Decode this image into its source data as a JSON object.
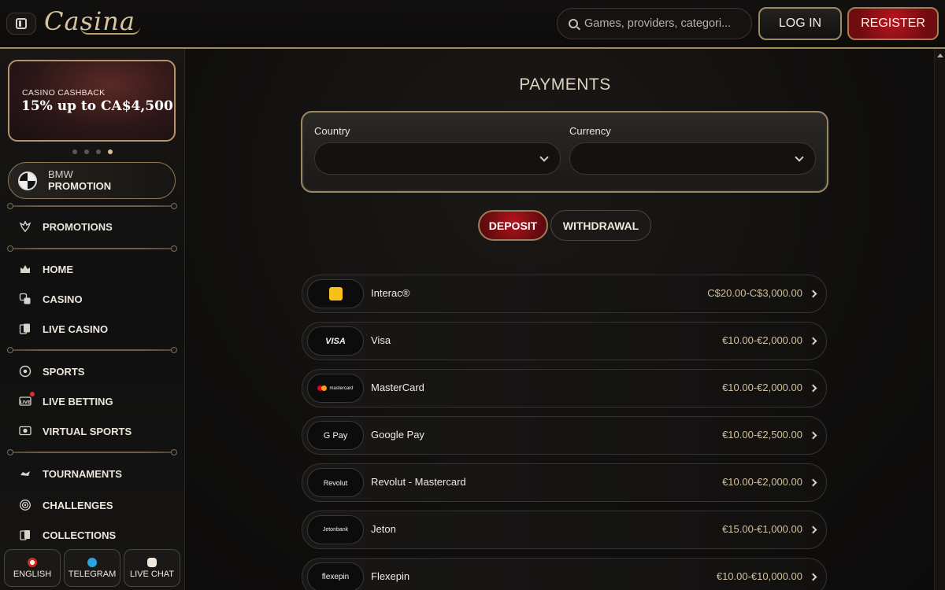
{
  "header": {
    "logo_text": "Casina",
    "search_placeholder": "Games, providers, categori...",
    "login_label": "LOG IN",
    "register_label": "REGISTER"
  },
  "sidebar": {
    "banner": {
      "kicker": "CASINO CASHBACK",
      "title": "15% up to CA$4,500",
      "slides": 4,
      "active_slide": 4
    },
    "bmw": {
      "line1": "BMW",
      "line2": "PROMOTION"
    },
    "items": [
      {
        "label": "PROMOTIONS",
        "icon": "promotions-icon"
      },
      {
        "label": "HOME",
        "icon": "home-icon"
      },
      {
        "label": "CASINO",
        "icon": "dice-icon"
      },
      {
        "label": "LIVE CASINO",
        "icon": "cards-icon"
      },
      {
        "label": "SPORTS",
        "icon": "soccer-ball-icon"
      },
      {
        "label": "LIVE BETTING",
        "icon": "live-icon"
      },
      {
        "label": "VIRTUAL SPORTS",
        "icon": "virtual-sports-icon"
      },
      {
        "label": "TOURNAMENTS",
        "icon": "tournaments-icon"
      },
      {
        "label": "CHALLENGES",
        "icon": "target-icon"
      },
      {
        "label": "COLLECTIONS",
        "icon": "collections-icon"
      }
    ],
    "footer": [
      {
        "label": "ENGLISH",
        "icon": "canada-flag-icon"
      },
      {
        "label": "TELEGRAM",
        "icon": "telegram-icon"
      },
      {
        "label": "LIVE CHAT",
        "icon": "chat-icon"
      }
    ]
  },
  "main": {
    "title": "PAYMENTS",
    "country_label": "Country",
    "currency_label": "Currency",
    "country_value": "",
    "currency_value": "",
    "tabs": [
      {
        "label": "DEPOSIT",
        "active": true
      },
      {
        "label": "WITHDRAWAL",
        "active": false
      }
    ],
    "methods": [
      {
        "name": "Interac®",
        "range": "C$20.00-C$3,000.00",
        "logo": "interac-logo"
      },
      {
        "name": "Visa",
        "range": "€10.00-€2,000.00",
        "logo": "VISA"
      },
      {
        "name": "MasterCard",
        "range": "€10.00-€2,000.00",
        "logo": "mastercard"
      },
      {
        "name": "Google Pay",
        "range": "€10.00-€2,500.00",
        "logo": "G Pay"
      },
      {
        "name": "Revolut - Mastercard",
        "range": "€10.00-€2,000.00",
        "logo": "Revolut"
      },
      {
        "name": "Jeton",
        "range": "€15.00-€1,000.00",
        "logo": "Jetonbank"
      },
      {
        "name": "Flexepin",
        "range": "€10.00-€10,000.00",
        "logo": "flexepin"
      }
    ]
  },
  "colors": {
    "accent_gold": "#b99d67",
    "accent_red": "#b5131d",
    "background": "#0f0d0c"
  }
}
